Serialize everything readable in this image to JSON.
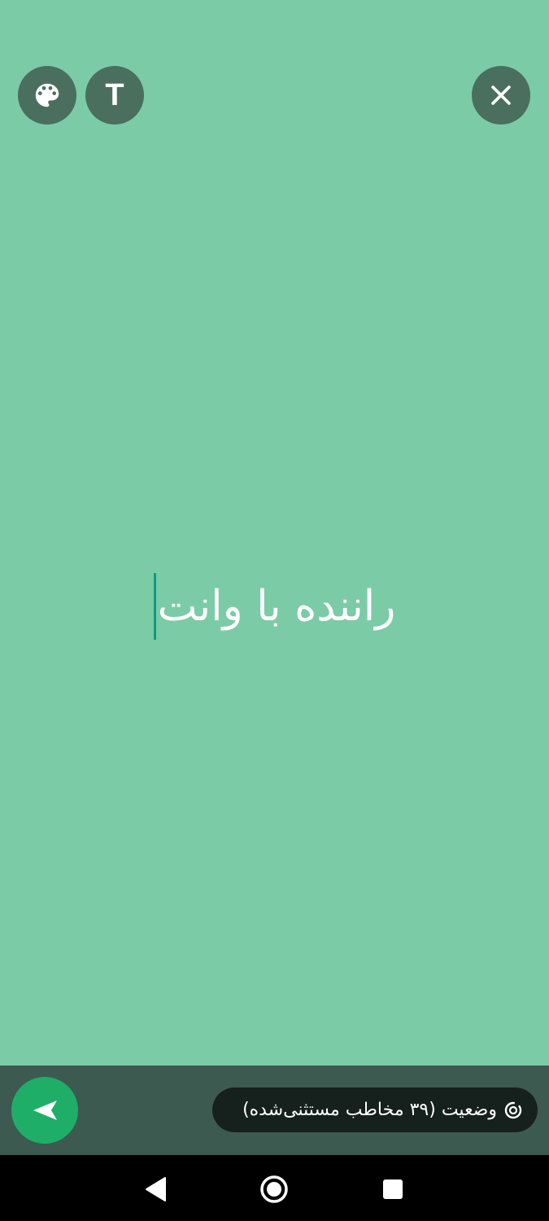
{
  "editor": {
    "status_text": "راننده با وانت",
    "background_color": "#7bcba7",
    "cursor_color": "#119a7a"
  },
  "toolbar": {
    "palette_icon": "palette-icon",
    "text_button_label": "T",
    "close_icon": "close-icon"
  },
  "footer": {
    "audience_label": "وضعیت (۳۹ مخاطب مستثنی‌شده)",
    "audience_icon": "status-ring-icon",
    "send_icon": "send-icon",
    "send_color": "#1fae67"
  },
  "nav": {
    "back_icon": "back-triangle-icon",
    "home_icon": "home-circle-icon",
    "recents_icon": "recents-square-icon"
  }
}
